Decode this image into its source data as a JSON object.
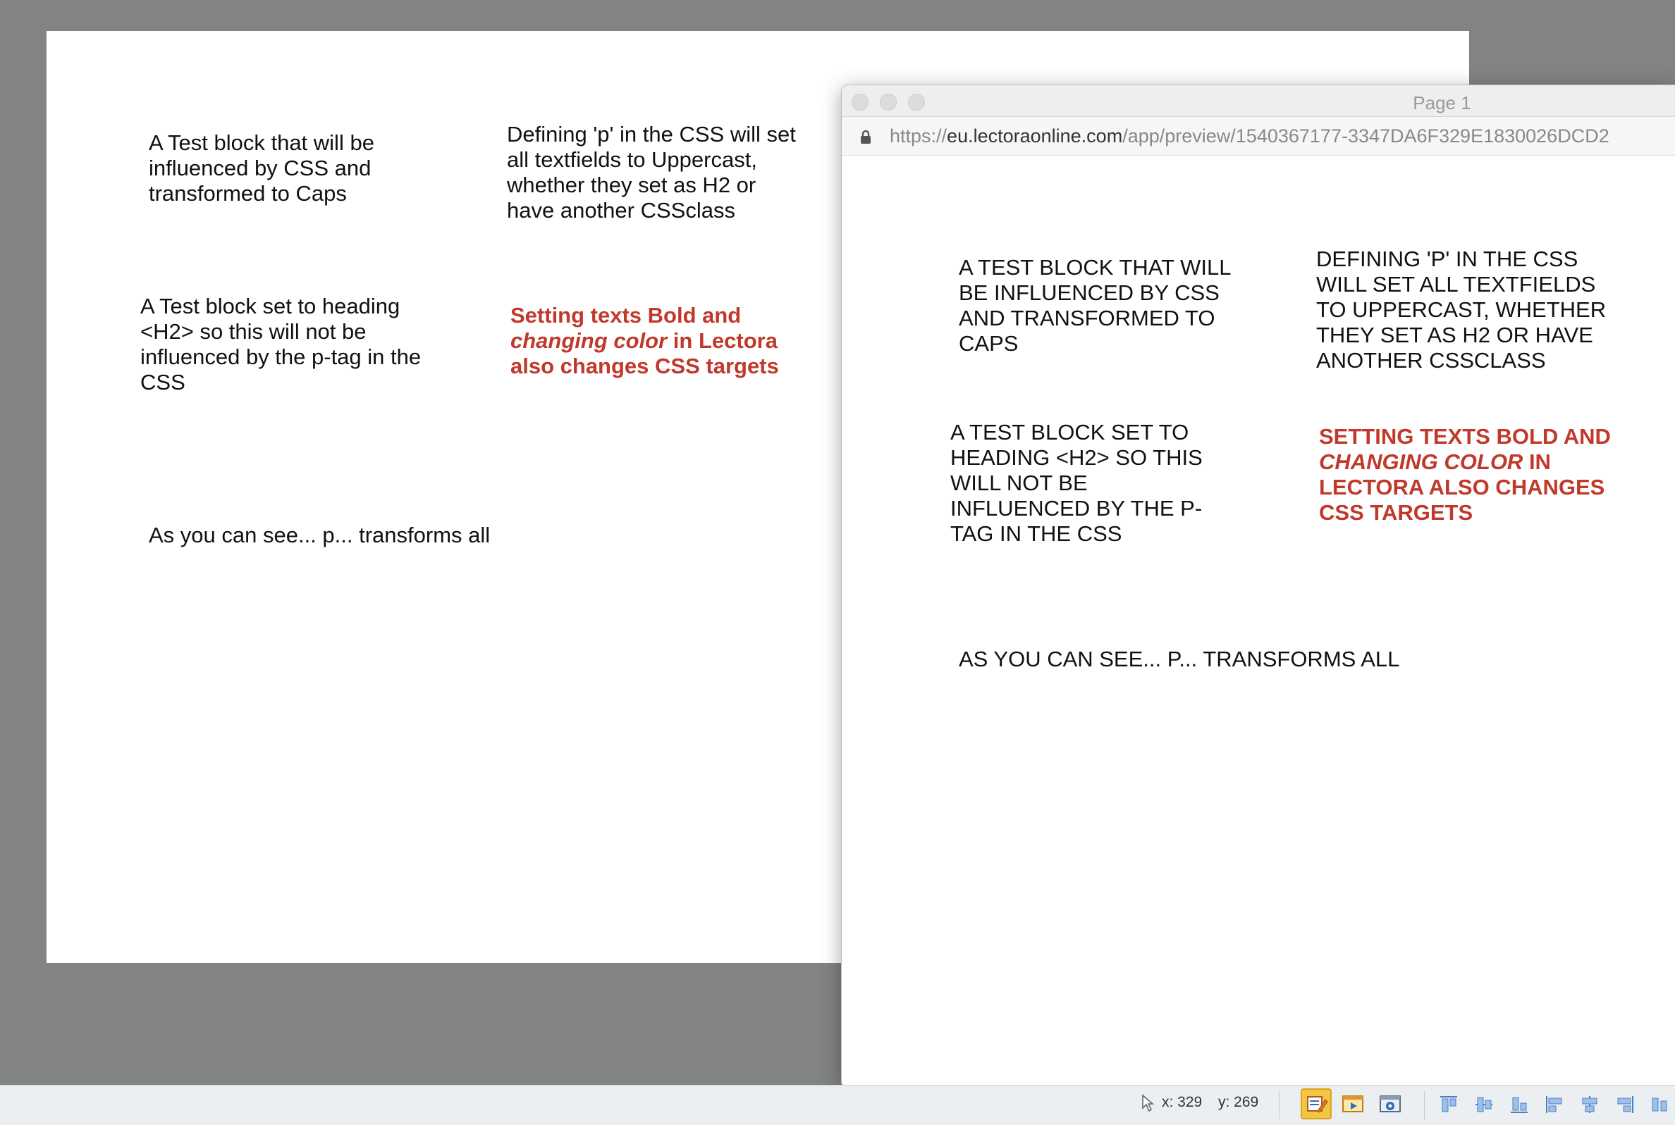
{
  "stage": {
    "block1": "A Test block that will be influenced by CSS and transformed to Caps",
    "block2": "Defining 'p' in the CSS will set all textfields to Uppercast, whether they set as H2 or have another CSSclass",
    "block3": "A Test block set to heading <H2> so this will not be influenced by the p-tag in the CSS",
    "block4_a": "Setting texts Bold and ",
    "block4_em": "changing color",
    "block4_b": " in Lectora also changes CSS targets",
    "block5": "As you can see... p... transforms all"
  },
  "preview": {
    "window_title": "Page 1",
    "url_scheme": "https://",
    "url_host": "eu.lectoraonline.com",
    "url_path": "/app/preview/1540367177-3347DA6F329E1830026DCD2",
    "block1": "A TEST BLOCK THAT WILL BE INFLUENCED BY CSS AND TRANSFORMED TO CAPS",
    "block2": "DEFINING 'P' IN THE CSS WILL SET ALL TEXTFIELDS TO UPPERCAST, WHETHER THEY SET AS H2 OR HAVE ANOTHER CSSCLASS",
    "block3": "A TEST BLOCK SET TO HEADING <H2> SO THIS WILL NOT BE INFLUENCED BY THE P-TAG IN THE CSS",
    "block4_a": "SETTING TEXTS BOLD AND ",
    "block4_em": "CHANGING COLOR",
    "block4_b": " IN LECTORA ALSO CHANGES CSS TARGETS",
    "block5": "AS YOU CAN SEE... P... TRANSFORMS ALL"
  },
  "statusbar": {
    "x_label": "x: 329",
    "y_label": "y: 269"
  },
  "colors": {
    "accent_red": "#c0392b",
    "stage_bg": "#828482"
  }
}
